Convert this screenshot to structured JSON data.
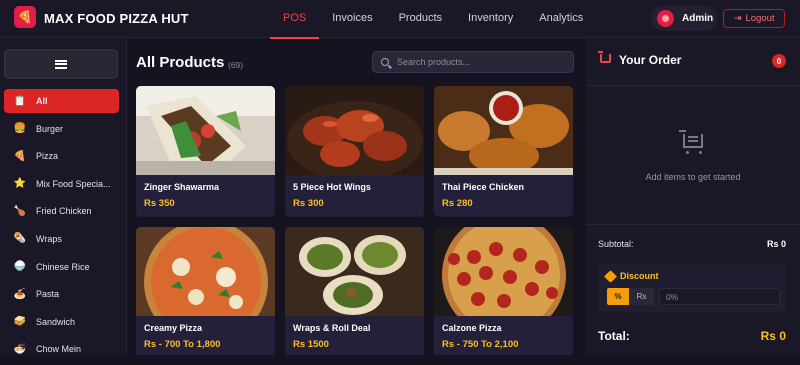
{
  "brand": {
    "name": "MAX FOOD PIZZA HUT",
    "logo_icon": "🍕"
  },
  "nav": [
    "POS",
    "Invoices",
    "Products",
    "Inventory",
    "Analytics"
  ],
  "user": {
    "name": "Admin",
    "logout_label": "Logout",
    "logout_icon": "⇥"
  },
  "categories": [
    {
      "icon": "📋",
      "label": "All"
    },
    {
      "icon": "🍔",
      "label": "Burger"
    },
    {
      "icon": "🍕",
      "label": "Pizza"
    },
    {
      "icon": "⭐",
      "label": "Mix Food Specia..."
    },
    {
      "icon": "🍗",
      "label": "Fried Chicken"
    },
    {
      "icon": "🌯",
      "label": "Wraps"
    },
    {
      "icon": "🍚",
      "label": "Chinese Rice"
    },
    {
      "icon": "🍝",
      "label": "Pasta"
    },
    {
      "icon": "🥪",
      "label": "Sandwich"
    },
    {
      "icon": "🍜",
      "label": "Chow Mein"
    }
  ],
  "products_section": {
    "title": "All Products",
    "count": "(69)",
    "search_placeholder": "Search products..."
  },
  "products": [
    {
      "name": "Zinger Shawarma",
      "price": "Rs 350"
    },
    {
      "name": "5 Piece Hot Wings",
      "price": "Rs 300"
    },
    {
      "name": "Thai Piece Chicken",
      "price": "Rs 280"
    },
    {
      "name": "Creamy Pizza",
      "price": "Rs - 700 To 1,800"
    },
    {
      "name": "Wraps & Roll Deal",
      "price": "Rs 1500"
    },
    {
      "name": "Calzone Pizza",
      "price": "Rs - 750 To 2,100"
    }
  ],
  "order": {
    "title": "Your Order",
    "count": "0",
    "empty_text": "Add items to get started",
    "subtotal_label": "Subtotal:",
    "subtotal_value": "Rs 0",
    "discount_label": "Discount",
    "discount_percent": "%",
    "discount_rs": "Rs",
    "discount_value": "0%",
    "total_label": "Total:",
    "total_value": "Rs 0"
  },
  "colors": {
    "accent": "#dc2626",
    "price": "#fbbf24",
    "bg": "#161321"
  }
}
